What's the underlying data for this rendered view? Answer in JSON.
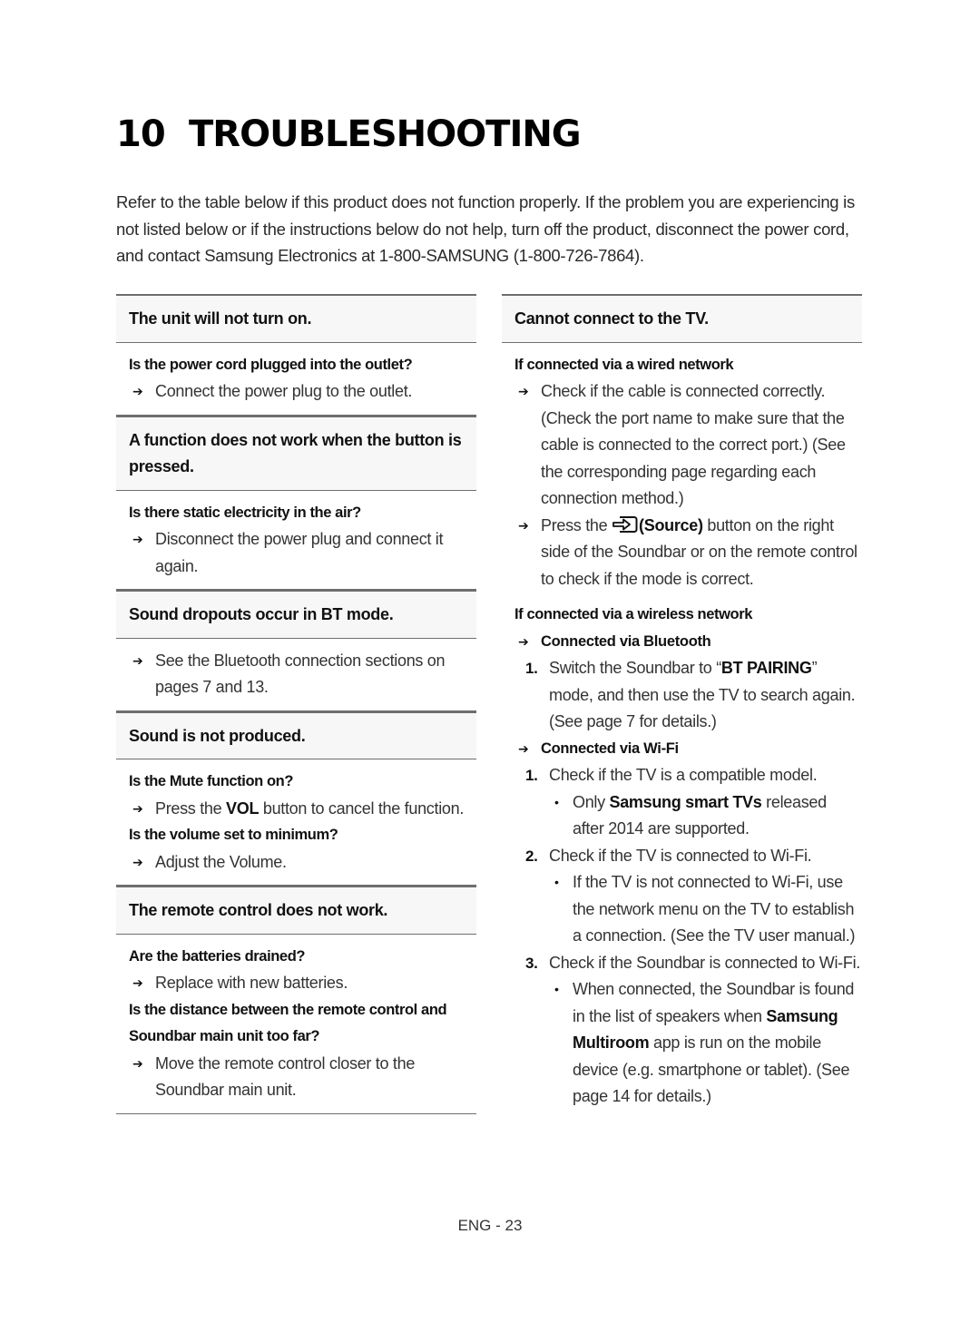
{
  "chapter": {
    "number": "10",
    "title": "TROUBLESHOOTING"
  },
  "intro": "Refer to the table below if this product does not function properly. If the problem you are experiencing is not listed below or if the instructions below do not help, turn off the product, disconnect the power cord, and contact Samsung Electronics at 1-800-SAMSUNG (1-800-726-7864).",
  "left": {
    "s1": {
      "header": "The unit will not turn on.",
      "q1": "Is the power cord plugged into the outlet?",
      "a1": "Connect the power plug to the outlet."
    },
    "s2": {
      "header": "A function does not work when the button is pressed.",
      "q1": "Is there static electricity in the air?",
      "a1": "Disconnect the power plug and connect it again."
    },
    "s3": {
      "header": "Sound dropouts occur in BT mode.",
      "a1": "See the Bluetooth connection sections on pages 7 and 13."
    },
    "s4": {
      "header": "Sound is not produced.",
      "q1": "Is the Mute function on?",
      "a1_pre": "Press the ",
      "a1_bold": "VOL",
      "a1_post": " button to cancel the function.",
      "q2": "Is the volume set to minimum?",
      "a2": "Adjust the Volume."
    },
    "s5": {
      "header": "The remote control does not work.",
      "q1": "Are the batteries drained?",
      "a1": "Replace with new batteries.",
      "q2": "Is the distance between the remote control and Soundbar main unit too far?",
      "a2": "Move the remote control closer to the Soundbar main unit."
    }
  },
  "right": {
    "header": "Cannot connect to the TV.",
    "wired": {
      "title": "If connected via a wired network",
      "a1": "Check if the cable is connected correctly. (Check the port name to make sure that the cable is connected to the correct port.) (See the corresponding page regarding each connection method.)",
      "a2_pre": "Press the ",
      "a2_icon": "source-icon",
      "a2_bold": "(Source)",
      "a2_post": " button on the right side of the Soundbar or on the remote control to check if the mode is correct."
    },
    "wireless": {
      "title": "If connected via a wireless network",
      "bt": {
        "title": "Connected via Bluetooth",
        "step1_num": "1.",
        "step1_pre": "Switch the Soundbar to “",
        "step1_bold": "BT PAIRING",
        "step1_post": "” mode, and then use the TV to search again. (See page 7 for details.)"
      },
      "wifi": {
        "title": "Connected via Wi-Fi",
        "step1_num": "1.",
        "step1": "Check if the TV is a compatible model.",
        "step1_bullet_pre": "Only ",
        "step1_bullet_bold": "Samsung smart TVs",
        "step1_bullet_post": " released after 2014 are supported.",
        "step2_num": "2.",
        "step2": "Check if the TV is connected to Wi-Fi.",
        "step2_bullet": "If the TV is not connected to Wi-Fi, use the network menu on the TV to establish a connection. (See the TV user manual.)",
        "step3_num": "3.",
        "step3": "Check if the Soundbar is connected to Wi-Fi.",
        "step3_bullet_pre": "When connected, the Soundbar is found in the list of speakers when ",
        "step3_bullet_bold": "Samsung Multiroom",
        "step3_bullet_post": " app is run on the mobile device (e.g. smartphone or tablet). (See page 14 for details.)"
      }
    }
  },
  "glyphs": {
    "arrow": "➔",
    "bullet": "•"
  },
  "footer": "ENG - 23"
}
